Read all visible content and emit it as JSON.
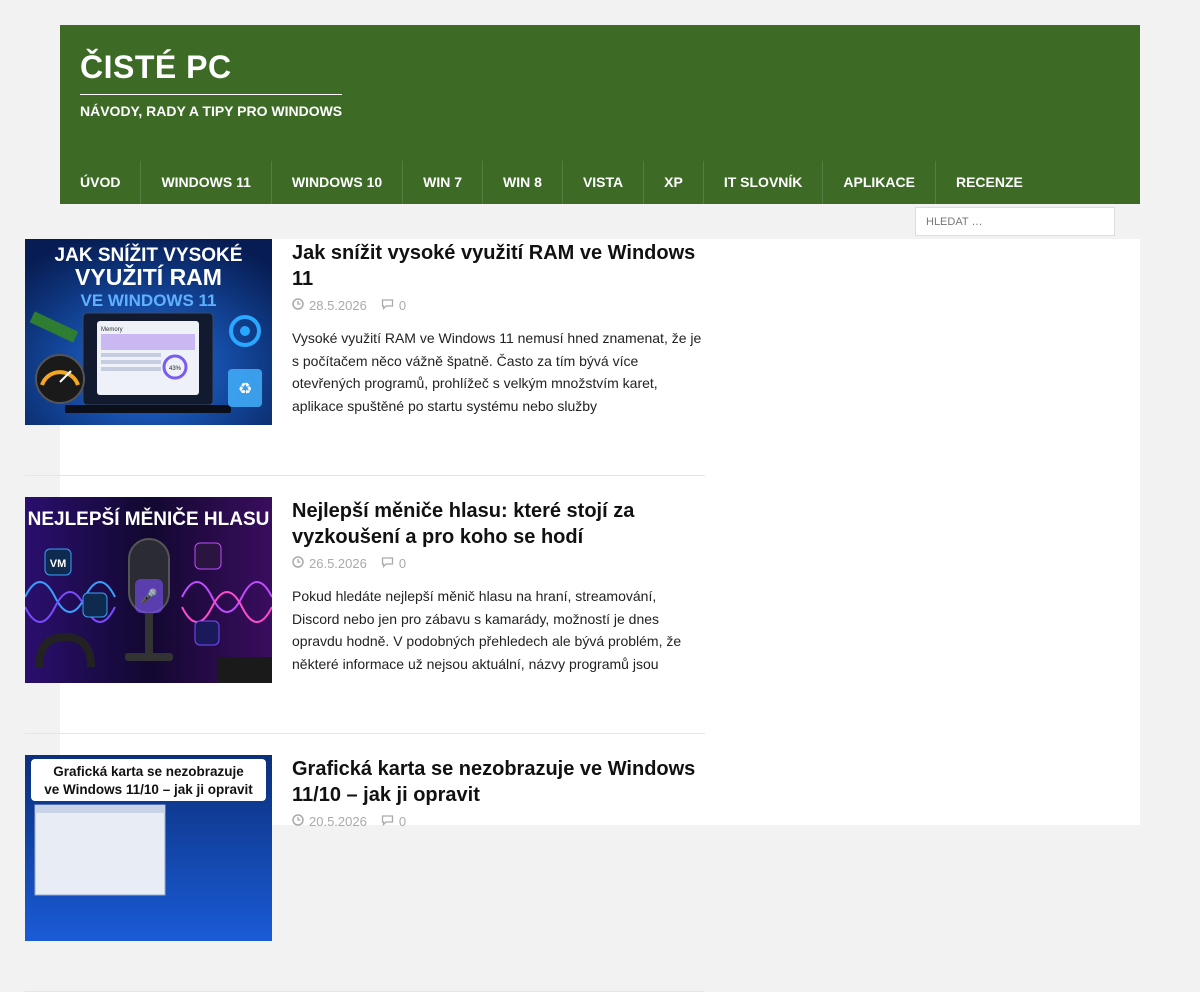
{
  "site": {
    "title": "ČISTÉ PC",
    "description": "NÁVODY, RADY A TIPY PRO WINDOWS"
  },
  "nav": {
    "items": [
      "ÚVOD",
      "WINDOWS 11",
      "WINDOWS 10",
      "WIN 7",
      "WIN 8",
      "VISTA",
      "XP",
      "IT SLOVNÍK",
      "APLIKACE",
      "RECENZE"
    ]
  },
  "search": {
    "placeholder": "HLEDAT …"
  },
  "posts": [
    {
      "title": "Jak snížit vysoké využití RAM ve Windows 11",
      "date": "28.5.2026",
      "comments": "0",
      "excerpt": "Vysoké využití RAM ve Windows 11 nemusí hned znamenat, že je s počítačem něco vážně špatně. Často za tím bývá více otevřených programů, prohlížeč s velkým množstvím karet, aplikace spuštěné po startu systému nebo služby",
      "thumb": {
        "line1": "JAK SNÍŽIT VYSOKÉ",
        "line2": "VYUŽITÍ RAM",
        "line3": "VE WINDOWS 11",
        "panel_title": "Memory",
        "gauge_value": "43%",
        "bg": "#0a2a6b"
      }
    },
    {
      "title": "Nejlepší měniče hlasu: které stojí za vyzkoušení a pro koho se hodí",
      "date": "26.5.2026",
      "comments": "0",
      "excerpt": "Pokud hledáte nejlepší měnič hlasu na hraní, streamování, Discord nebo jen pro zábavu s kamarády, možností je dnes opravdu hodně. V podobných přehledech ale bývá problém, že některé informace už nejsou aktuální, názvy programů jsou",
      "thumb": {
        "line1": "NEJLEPŠÍ MĚNIČE HLASU",
        "bg": "#140a3a"
      }
    },
    {
      "title": "Grafická karta se nezobrazuje ve Windows 11/10 – jak ji opravit",
      "date": "20.5.2026",
      "comments": "0",
      "excerpt": "",
      "thumb": {
        "line1": "Grafická karta se nezobrazuje",
        "line2": "ve Windows 11/10 – jak ji opravit",
        "bg": "#0b2f7a"
      }
    }
  ],
  "colors": {
    "header_bg": "#3d6b26",
    "meta_gray": "#aaaaaa"
  }
}
